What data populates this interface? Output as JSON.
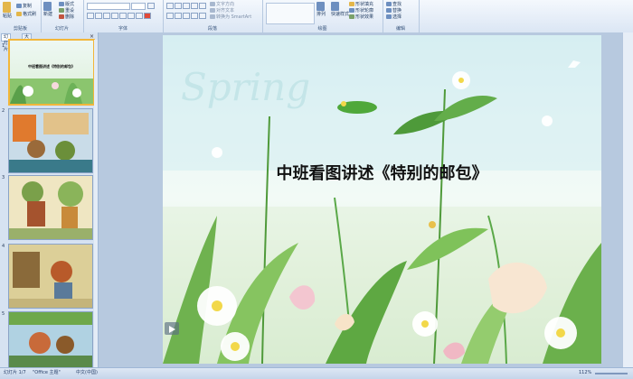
{
  "ribbon": {
    "clipboard": {
      "paste": "粘贴",
      "copy": "复制",
      "format_painter": "格式刷",
      "label": "剪贴板"
    },
    "slides": {
      "new_slide": "新建",
      "layout": "版式",
      "reset": "重设",
      "delete": "删除",
      "label": "幻灯片"
    },
    "font": {
      "label": "字体"
    },
    "paragraph": {
      "text_direction": "文字方向",
      "align_text": "对齐文本",
      "convert_smartart": "转换为 SmartArt",
      "label": "段落"
    },
    "drawing": {
      "arrange": "排列",
      "quick_styles": "快速样式",
      "shape_fill": "形状填充",
      "shape_outline": "形状轮廓",
      "shape_effects": "形状效果",
      "label": "绘图"
    },
    "editing": {
      "find": "查找",
      "replace": "替换",
      "select": "选择",
      "label": "编辑"
    }
  },
  "slides_pane": {
    "tabs": [
      "幻灯片",
      "大纲"
    ],
    "close": "×",
    "thumb_title": "中班看图讲述《特别的邮包》",
    "numbers": [
      "1",
      "2",
      "3",
      "4",
      "5"
    ]
  },
  "slide": {
    "title": "中班看图讲述《特别的邮包》",
    "watermark": "Spring"
  },
  "status_bar": {
    "slide_info": "幻灯片 1/7",
    "theme": "\"Office 主题\"",
    "language": "中文(中国)",
    "zoom": "112%"
  },
  "colors": {
    "accent": "#f2b63a",
    "ribbon": "#dbe6f4",
    "frame": "#b7c9df"
  }
}
